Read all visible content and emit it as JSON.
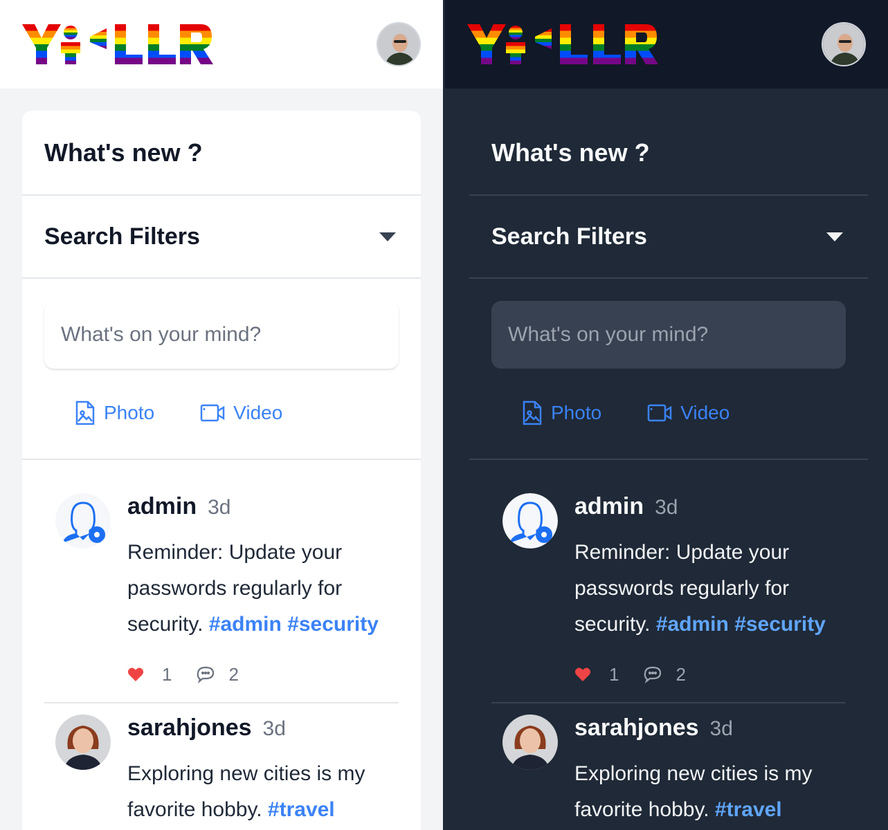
{
  "app": {
    "logo_text": "YELLR"
  },
  "feed": {
    "title": "What's new ?",
    "filters_label": "Search Filters",
    "composer": {
      "placeholder": "What's on your mind?",
      "photo_label": "Photo",
      "video_label": "Video"
    },
    "posts": [
      {
        "username": "admin",
        "time": "3d",
        "text": "Reminder: Update your passwords regularly for security.",
        "hashtags": [
          "#admin",
          "#security"
        ],
        "likes": "1",
        "comments": "2"
      },
      {
        "username": "sarahjones",
        "time": "3d",
        "text": "Exploring new cities is my favorite hobby.",
        "hashtags": [
          "#travel"
        ]
      }
    ]
  },
  "themes": [
    "light",
    "dark"
  ],
  "colors": {
    "accent": "#3b82f6",
    "like": "#ef4444",
    "dark_bg": "#1f2937",
    "dark_header": "#111827"
  }
}
